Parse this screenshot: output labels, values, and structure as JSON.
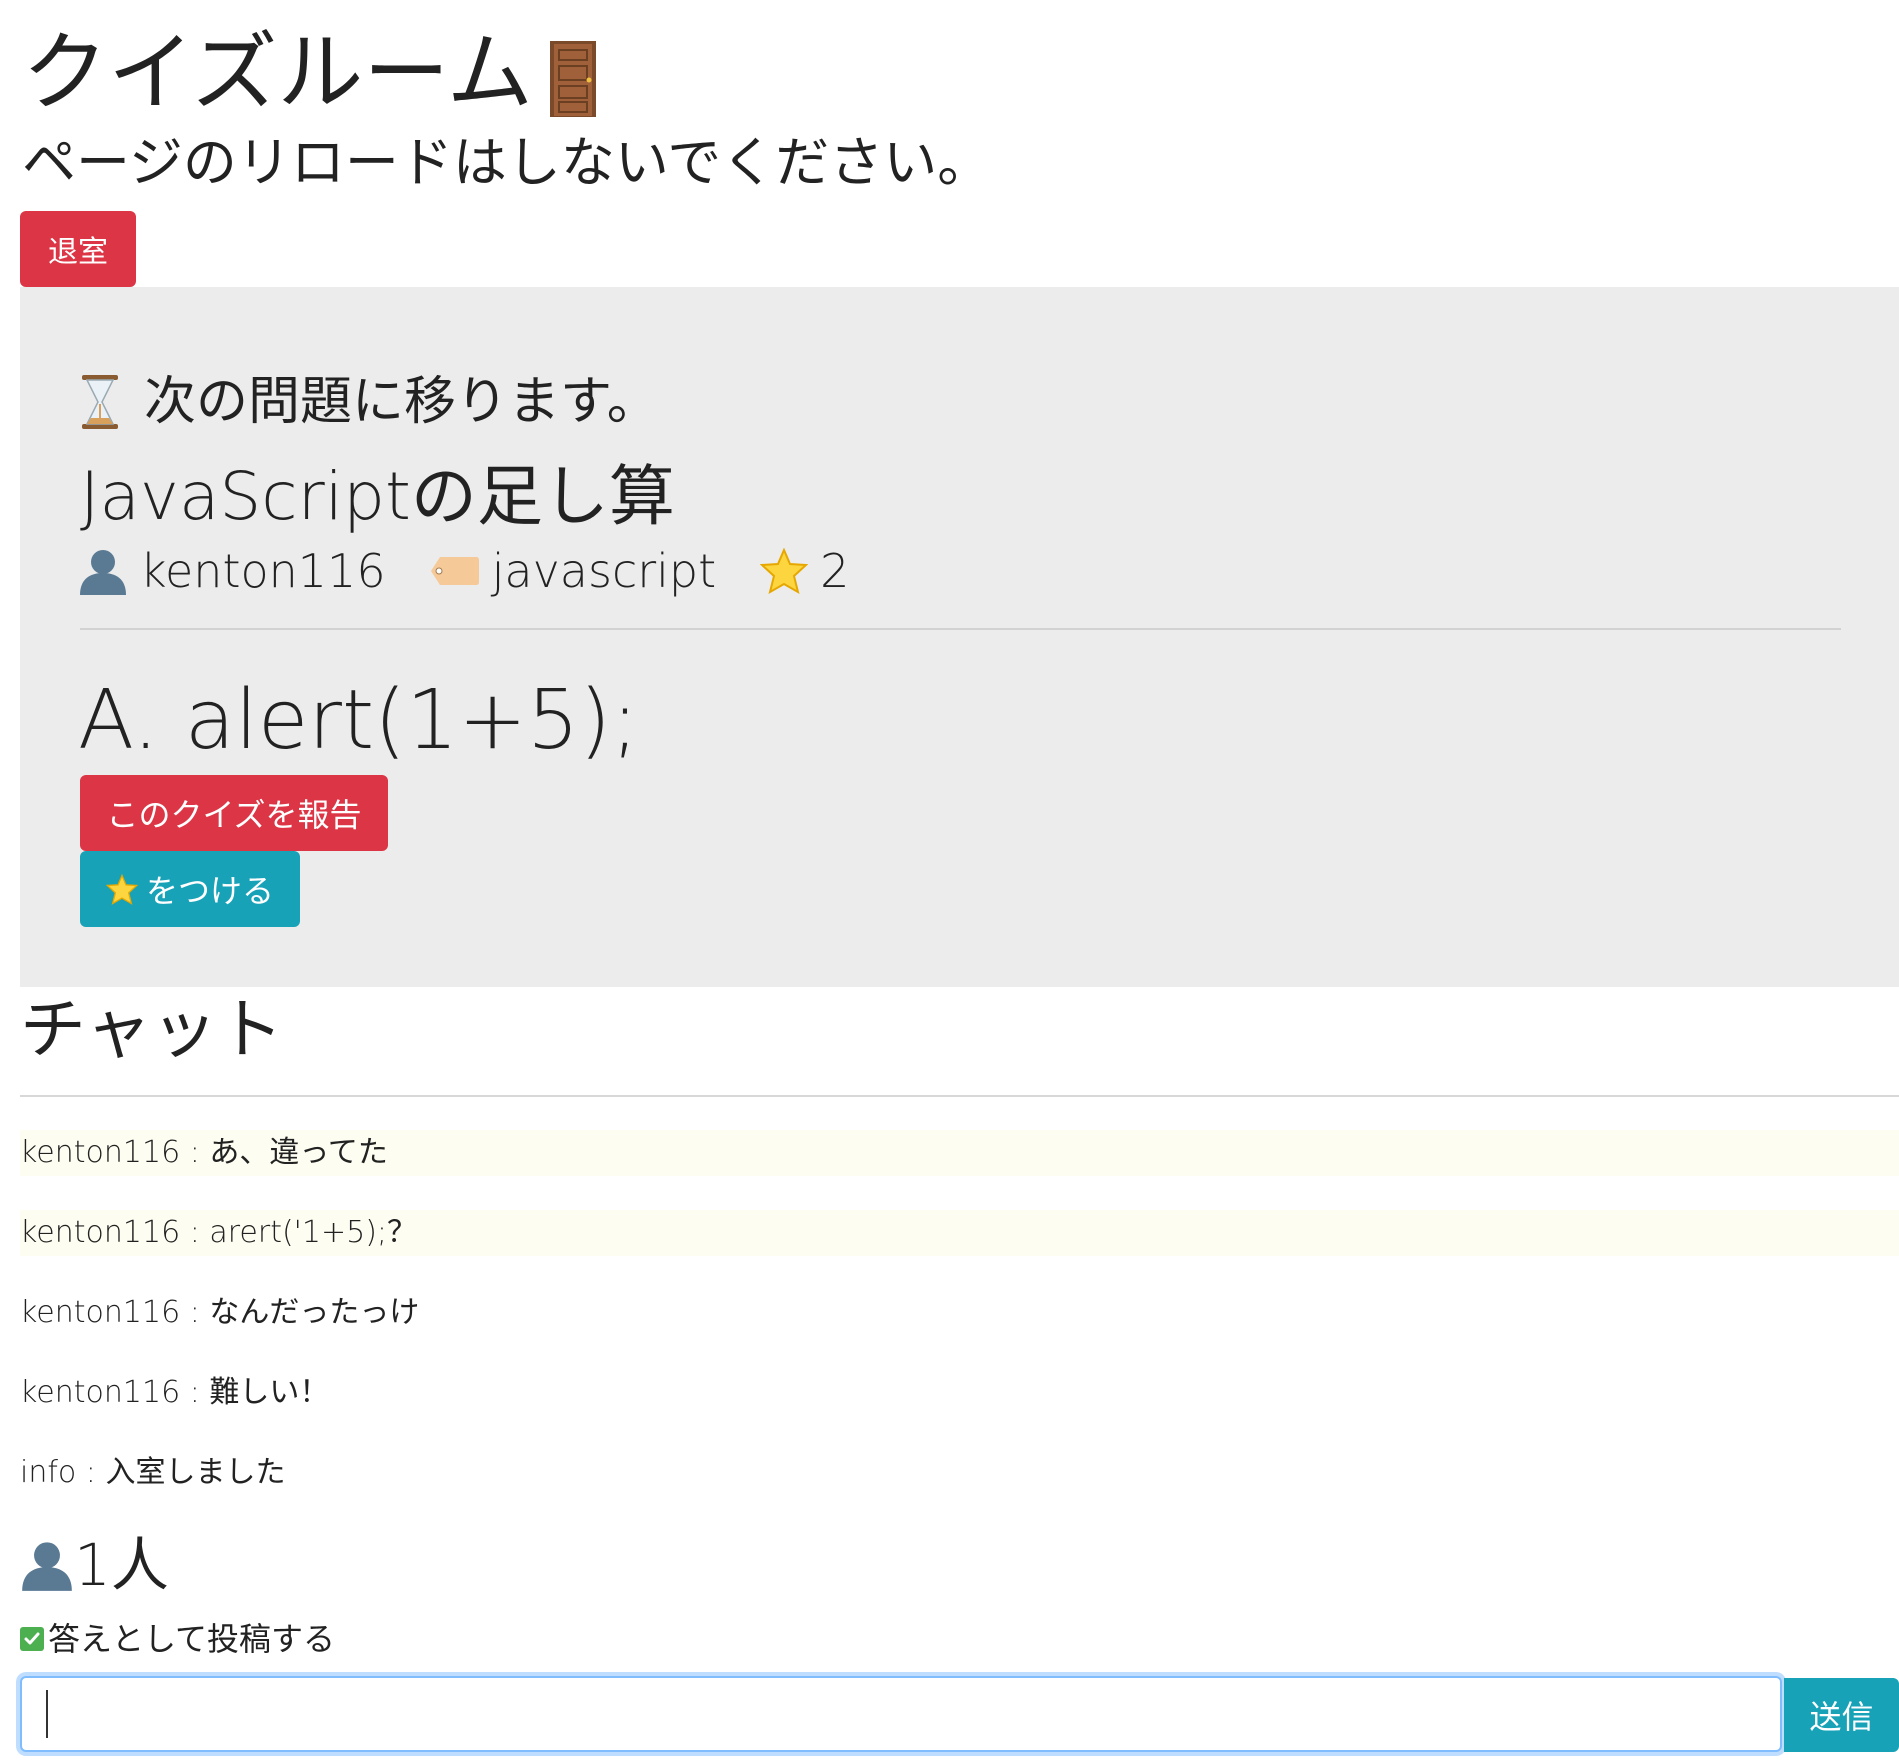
{
  "header": {
    "title": "クイズルーム",
    "notice": "ページのリロードはしないでください。",
    "leave_label": "退室"
  },
  "quiz": {
    "status": "次の問題に移ります。",
    "title": "JavaScriptの足し算",
    "author": "kenton116",
    "tag": "javascript",
    "stars": "2",
    "answer": "A. alert(1+5);",
    "report_label": "このクイズを報告",
    "star_label": "をつける"
  },
  "chat": {
    "heading": "チャット",
    "messages": [
      {
        "text": "kenton116 : あ、違ってた",
        "highlight": true
      },
      {
        "text": "kenton116 : arert('1+5);？",
        "highlight": true
      },
      {
        "text": "kenton116 : なんだったっけ",
        "highlight": false
      },
      {
        "text": "kenton116 : 難しい！",
        "highlight": false
      },
      {
        "text": "info : 入室しました",
        "highlight": false
      }
    ],
    "user_count": "1人",
    "post_as_answer_label": "答えとして投稿する",
    "post_as_answer_checked": true,
    "input_value": "",
    "send_label": "送信"
  },
  "icons": {
    "door": "door-icon",
    "hourglass": "hourglass-icon",
    "user": "user-icon",
    "tag": "tag-icon",
    "star": "star-icon",
    "check": "check-icon"
  },
  "colors": {
    "danger": "#dc3545",
    "info": "#17a2b8",
    "panel": "#ececec",
    "highlight_row": "#fdfdf1",
    "check": "#4caf50"
  }
}
